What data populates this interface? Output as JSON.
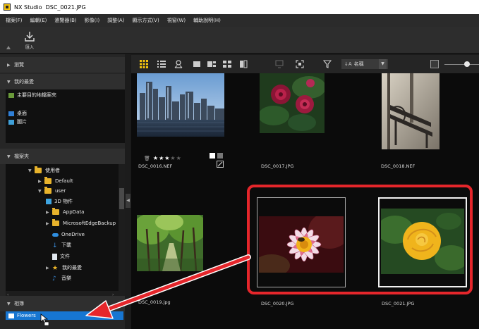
{
  "window": {
    "app_name": "NX Studio",
    "file_name": "DSC_0021.JPG"
  },
  "menu": [
    "檔案(F)",
    "編輯(E)",
    "瀏覽器(B)",
    "影像(I)",
    "調整(A)",
    "顯示方式(V)",
    "視窗(W)",
    "輔助說明(H)"
  ],
  "toolbar": {
    "import_label": "匯入"
  },
  "left_panel": {
    "browse": {
      "title": "瀏覽"
    },
    "favorites": {
      "title": "我的最愛",
      "items": [
        "主要目的地檔案夾",
        "桌面",
        "圖片"
      ]
    },
    "folders": {
      "title": "檔案夾",
      "items": [
        {
          "label": "使用者",
          "level": 0,
          "expanded": true,
          "icon": "folder"
        },
        {
          "label": "Default",
          "level": 1,
          "expanded": false,
          "icon": "folder"
        },
        {
          "label": "user",
          "level": 1,
          "expanded": true,
          "icon": "folder"
        },
        {
          "label": "3D 物件",
          "level": 2,
          "icon": "3d-object"
        },
        {
          "label": "AppData",
          "level": 2,
          "expanded": false,
          "icon": "folder"
        },
        {
          "label": "MicrosoftEdgeBackup",
          "level": 2,
          "expanded": false,
          "icon": "folder"
        },
        {
          "label": "OneDrive",
          "level": 2,
          "icon": "cloud"
        },
        {
          "label": "下載",
          "level": 2,
          "icon": "download-arrow"
        },
        {
          "label": "文件",
          "level": 2,
          "icon": "document"
        },
        {
          "label": "我的最愛",
          "level": 2,
          "expanded": false,
          "icon": "star"
        },
        {
          "label": "音樂",
          "level": 2,
          "icon": "music-note"
        }
      ]
    },
    "albums": {
      "title": "相簿",
      "items": [
        "Flowers"
      ]
    }
  },
  "content_toolbar": {
    "sort_label": "名稱"
  },
  "thumbnails": [
    {
      "file": "DSC_0016.NEF",
      "rating": 3,
      "max_rating": 5,
      "subject": "city skyline"
    },
    {
      "file": "DSC_0017.JPG",
      "subject": "red flowers"
    },
    {
      "file": "DSC_0018.NEF",
      "subject": "park bench"
    },
    {
      "file": "DSC_0019.jpg",
      "subject": "tree-lined path"
    },
    {
      "file": "DSC_0020.JPG",
      "subject": "dahlia with bee",
      "selected": true
    },
    {
      "file": "DSC_0021.JPG",
      "subject": "yellow rose",
      "selected": true,
      "active": true
    }
  ],
  "colors": {
    "highlight": "#e5262b",
    "selection": "#1776d2",
    "folder": "#e8b32c",
    "accent": "#f2c20f"
  }
}
